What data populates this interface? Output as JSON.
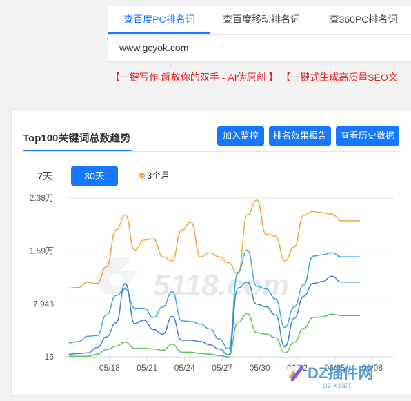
{
  "search": {
    "tabs": [
      {
        "label": "查百度PC排名词",
        "active": true
      },
      {
        "label": "查百度移动排名词",
        "active": false
      },
      {
        "label": "查360PC排名词",
        "active": false
      }
    ],
    "domain": "www.gcyok.com"
  },
  "promo": {
    "part1": "【一键写作 解放你的双手 - AI伪原创 】",
    "part2": "【一键式生成高质量SEO文"
  },
  "panel": {
    "title": "Top100关键词总数趋势",
    "buttons": {
      "monitor": "加入监控",
      "report": "排名效果报告",
      "history": "查看历史数据"
    },
    "ranges": {
      "r7": "7天",
      "r30": "30天",
      "r3m": "3个月"
    }
  },
  "watermark": {
    "center_text": "5118.com",
    "badge_text": "DZ插件网",
    "badge_sub": "DZ-X.NET"
  },
  "chart_data": {
    "type": "line",
    "y_ticks": [
      "2.38万",
      "1.59万",
      "7,943",
      "16"
    ],
    "y_tick_values": [
      23800,
      15900,
      7943,
      16
    ],
    "ylim": [
      16,
      23800
    ],
    "x_tick_labels": [
      "05/18",
      "05/21",
      "05/24",
      "05/27",
      "05/30",
      "06/02",
      "06/05",
      "06/08"
    ],
    "x": [
      0,
      1,
      2,
      3,
      4,
      5,
      6,
      7,
      8,
      9,
      10,
      11,
      12,
      13,
      14,
      15,
      16,
      17,
      18,
      19,
      20,
      21,
      22,
      23,
      24,
      25,
      26,
      27,
      28,
      29,
      30,
      31
    ],
    "series": [
      {
        "color": "#f4a23a",
        "values": [
          10300,
          10400,
          11200,
          11000,
          13500,
          19000,
          21300,
          16000,
          17500,
          17700,
          15000,
          14400,
          19000,
          20200,
          15000,
          15600,
          15000,
          14100,
          12400,
          21300,
          23500,
          18400,
          18100,
          14400,
          16500,
          21200,
          21800,
          21600,
          21400,
          20400,
          20400,
          20400
        ]
      },
      {
        "color": "#3da7dc",
        "values": [
          2100,
          2300,
          3100,
          3200,
          6300,
          9200,
          10200,
          7300,
          7300,
          5900,
          7500,
          9800,
          5400,
          5300,
          4900,
          4200,
          2700,
          1200,
          12700,
          16000,
          10600,
          10200,
          8700,
          4400,
          7500,
          10800,
          15100,
          15300,
          15600,
          15000,
          15000,
          15000
        ]
      },
      {
        "color": "#3a7fd6",
        "values": [
          400,
          500,
          600,
          1400,
          3000,
          5100,
          11000,
          5000,
          5500,
          4100,
          3400,
          6100,
          2500,
          2500,
          2300,
          1800,
          1200,
          300,
          10300,
          11200,
          7900,
          7500,
          6300,
          1500,
          5800,
          9100,
          11000,
          11300,
          12100,
          11200,
          11200,
          11200
        ]
      },
      {
        "color": "#5fc35a",
        "values": [
          100,
          100,
          100,
          400,
          1100,
          1600,
          2200,
          1300,
          1300,
          1200,
          1000,
          1900,
          700,
          700,
          500,
          400,
          200,
          16,
          5200,
          6500,
          3600,
          3400,
          2900,
          600,
          2200,
          4300,
          5900,
          6000,
          6400,
          6200,
          6200,
          6200
        ]
      }
    ]
  }
}
